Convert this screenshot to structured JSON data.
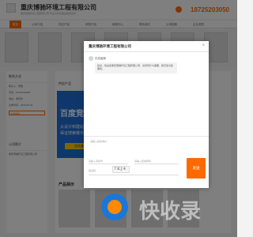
{
  "header": {
    "company_name": "重庆博驰环境工程有限公司",
    "subtitle": "重庆博驰环境工程有限公司 专业污水处理设备供应商",
    "phone": "18725203050"
  },
  "nav": {
    "items": [
      "首页",
      "公司介绍",
      "供应产品",
      "采购产品",
      "新闻中心",
      "联系我们",
      "公司相册",
      "企业资质"
    ]
  },
  "left_panel": {
    "contact_title": "联系方式",
    "rows": [
      "联系人：博驰",
      "手机：18725203050",
      "地址：重庆市",
      "注册时间：2023-06-02"
    ],
    "btn_label": "在线留言",
    "intro_title": "公司简介",
    "intro_text": "重庆博驰环境工程有限公司"
  },
  "right_panel": {
    "section_title": "供应产品",
    "ad": {
      "line1": "百度竞价",
      "line2": "从设计到建站",
      "line3": "保证搜索曝光",
      "cta": "点击查看"
    },
    "products_title": "产品展示"
  },
  "dialog": {
    "title": "重庆博驰环境工程有限公司",
    "close_glyph": "×",
    "sender": "在线客服",
    "message": "您好，欢迎来重庆博驰环境工程有限公司，请问有什么需要，我们来为您服务。",
    "textarea_placeholder": "请输入您的询价",
    "phone_placeholder": "请输入手机号",
    "name_placeholder": "请输入您的称呼",
    "captcha_placeholder": "验证码",
    "captcha_text": "7KJ4",
    "send_label": "发送"
  },
  "watermark": {
    "text": "快收录"
  }
}
